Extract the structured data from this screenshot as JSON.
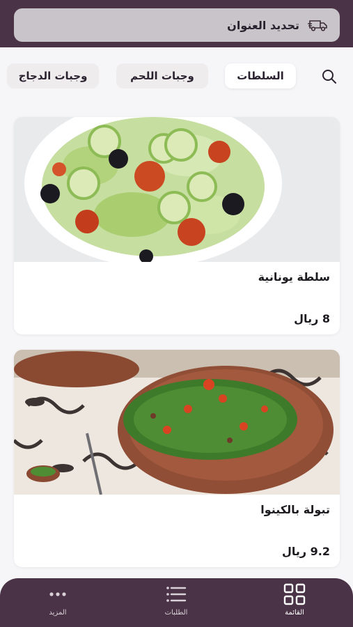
{
  "header": {
    "address_label": "تحديد العنوان",
    "icon": "delivery-truck-icon"
  },
  "categories": {
    "search_icon": "search-icon",
    "tabs": [
      {
        "label": "السلطات",
        "active": true
      },
      {
        "label": "وجبات اللحم",
        "active": false
      },
      {
        "label": "وجبات الدجاج",
        "active": false
      }
    ]
  },
  "products": [
    {
      "name": "سلطة يونانية",
      "price": "8 ريال"
    },
    {
      "name": "تبولة بالكينوا",
      "price": "9.2 ريال"
    }
  ],
  "bottom_nav": {
    "items": [
      {
        "label": "القائمة",
        "icon": "grid-icon",
        "active": true
      },
      {
        "label": "الطلبات",
        "icon": "list-icon",
        "active": false
      },
      {
        "label": "المزيد",
        "icon": "more-dots-icon",
        "active": false
      }
    ]
  },
  "colors": {
    "brand": "#4b3347",
    "background": "#f6f5f7",
    "card": "#ffffff"
  }
}
